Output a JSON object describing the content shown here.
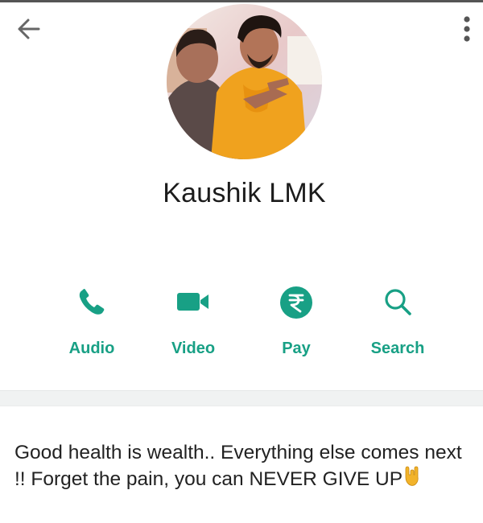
{
  "header": {
    "back_icon": "arrow-left-icon",
    "more_icon": "more-vertical-icon"
  },
  "profile": {
    "name": "Kaushik LMK"
  },
  "actions": [
    {
      "label": "Audio",
      "icon": "phone-icon"
    },
    {
      "label": "Video",
      "icon": "video-camera-icon"
    },
    {
      "label": "Pay",
      "icon": "rupee-icon"
    },
    {
      "label": "Search",
      "icon": "search-icon"
    }
  ],
  "about": {
    "text": "Good health is wealth.. Everything else comes next !! Forget the pain, you can NEVER GIVE UP",
    "emoji_icon": "rock-on-hand-icon"
  },
  "colors": {
    "accent": "#18a085",
    "text": "#1c1c1c",
    "divider": "#f0f2f2"
  }
}
